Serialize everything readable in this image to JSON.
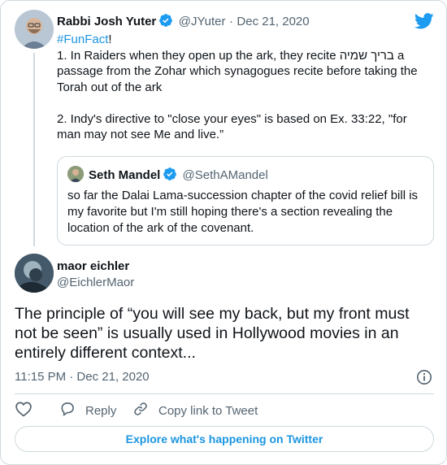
{
  "parent_tweet": {
    "author_name": "Rabbi Josh Yuter",
    "handle": "@JYuter",
    "separator": "·",
    "date": "Dec 21, 2020",
    "hashtag": "#FunFact",
    "hashtag_suffix": "!",
    "lines": [
      "1. In Raiders when they open up the ark, they recite בריך שמיה a",
      "passage from the Zohar which synagogues recite before taking the",
      "Torah out of the ark",
      "",
      "2. Indy's directive to \"close your eyes\" is based on Ex. 33:22, \"for",
      "man may not see Me and live.”"
    ]
  },
  "quoted_tweet": {
    "author_name": "Seth Mandel",
    "handle": "@SethAMandel",
    "lines": [
      "so far the Dalai Lama-succession chapter of the covid relief bill is",
      "my favorite but I'm still hoping there's a section revealing the",
      "location of the ark of the covenant."
    ]
  },
  "reply_tweet": {
    "author_name": "maor eichler",
    "handle": "@EichlerMaor",
    "lines": [
      "The principle of “you will see my back, but my front must",
      "not be seen” is usually used in Hollywood movies in an",
      "entirely different context..."
    ],
    "timestamp": "11:15 PM · Dec 21, 2020"
  },
  "actions": {
    "reply_label": "Reply",
    "copy_link_label": "Copy link to Tweet"
  },
  "explore_label": "Explore what's happening on Twitter",
  "colors": {
    "accent": "#1b95e0",
    "verified": "#1d9bf0",
    "twitter_logo": "#1d9bf0",
    "text": "#0f1419",
    "muted": "#536471",
    "border": "#cfd9de"
  },
  "icons": [
    "twitter-bird-icon",
    "verified-badge-icon",
    "info-icon",
    "heart-icon",
    "reply-bubble-icon",
    "link-icon"
  ]
}
